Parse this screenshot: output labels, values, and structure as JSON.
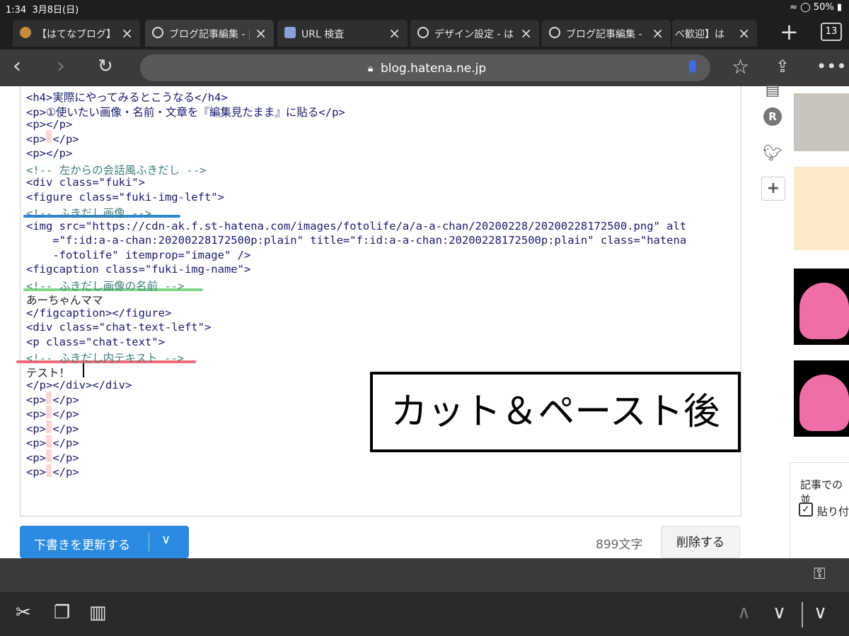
{
  "status": {
    "time": "1:34",
    "date": "3月8日(日)",
    "battery": "50%"
  },
  "tabs": [
    {
      "label": "【はてなブログ】\\",
      "active": false
    },
    {
      "label": "ブログ記事編集 - |",
      "active": true
    },
    {
      "label": "URL 検査",
      "active": false
    },
    {
      "label": "デザイン設定 - は",
      "active": false
    },
    {
      "label": "ブログ記事編集 -",
      "active": false
    },
    {
      "label": "べ歓迎】は",
      "active": false
    }
  ],
  "tab_count": "13",
  "nav": {
    "url": "blog.hatena.ne.jp"
  },
  "editor": {
    "lines": [
      "<h4>実際にやってみるとこうなる</h4>",
      "<p>①使いたい画像・名前・文章を『編集見たまま』に貼る</p>",
      "<p></p>",
      "<p> </p>",
      "<p></p>",
      "<!-- 左からの会話風ふきだし -->",
      "<div class=\"fuki\">",
      "<figure class=\"fuki-img-left\">",
      "<!-- ふきだし画像 -->",
      "<img src=\"https://cdn-ak.f.st-hatena.com/images/fotolife/a/a-a-chan/20200228/20200228172500.png\" alt",
      "    =\"f:id:a-a-chan:20200228172500p:plain\" title=\"f:id:a-a-chan:20200228172500p:plain\" class=\"hatena",
      "    -fotolife\" itemprop=\"image\" />",
      "<figcaption class=\"fuki-img-name\">",
      "<!-- ふきだし画像の名前 -->",
      "あーちゃんママ",
      "</figcaption></figure>",
      "<div class=\"chat-text-left\">",
      "<p class=\"chat-text\">",
      "<!-- ふきだし内テキスト -->",
      "テスト！",
      "</p></div></div>",
      "<p> </p>",
      "<p> </p>",
      "<p> </p>",
      "<p> </p>",
      "<p> </p>",
      "<p> </p>"
    ]
  },
  "overlay_text": "カット＆ペースト後",
  "actions": {
    "update_label": "下書きを更新する",
    "char_count": "899文字",
    "delete_label": "削除する"
  },
  "sidebar": {
    "card_text": "記事での並",
    "checkbox_label": "貼り付"
  },
  "colors": {
    "accent": "#2b8be0",
    "blue_mark": "#2b87d8",
    "green_mark": "#82d688",
    "red_mark": "#ee6b78"
  }
}
